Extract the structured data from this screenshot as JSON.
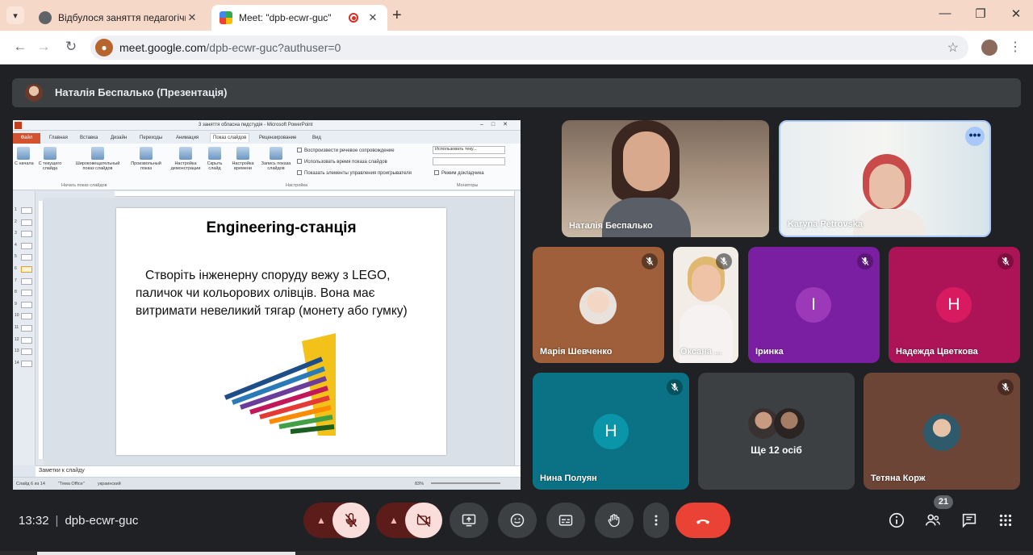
{
  "browser": {
    "tabs": [
      {
        "title": "Відбулося заняття педагогічно",
        "active": false
      },
      {
        "title": "Meet: \"dpb-ecwr-guc\"",
        "active": true,
        "recording": true
      }
    ],
    "url_host": "meet.google.com",
    "url_path": "/dpb-ecwr-guc?authuser=0"
  },
  "presenter": {
    "label": "Наталія Беспалько (Презентація)"
  },
  "ppt": {
    "window_title": "3 заняття обласна педстудія  -  Microsoft PowerPoint",
    "file_tab": "Файл",
    "tabs": [
      "Главная",
      "Вставка",
      "Дизайн",
      "Переходы",
      "Анимация",
      "Показ слайдов",
      "Рецензирование",
      "Вид"
    ],
    "ribbon_buttons": [
      "С начала",
      "С текущего слайда",
      "Широковещательный показ слайдов",
      "Произвольный показ",
      "Настройка демонстрации",
      "Скрыть слайд",
      "Настройка времени",
      "Запись показа слайдов"
    ],
    "checkboxes": [
      "Воспроизвести речевое сопровождение",
      "Использовать время показа слайдов",
      "Показать элементы управления проигрывателя"
    ],
    "monitor_select": "Использовать теку...",
    "presenter_view": "Режим докладчика",
    "groups": [
      "Начать показ слайдов",
      "Настройка",
      "Мониторы"
    ],
    "slide_numbers": [
      "1",
      "2",
      "3",
      "4",
      "5",
      "6",
      "7",
      "8",
      "9",
      "10",
      "11",
      "12",
      "13",
      "14"
    ],
    "slide": {
      "title": "Engineering-станція",
      "body": "Створіть інженерну споруду  вежу з LEGO, паличок чи кольорових олівців. Вона має витримати невеликий тягар (монету або гумку)"
    },
    "notes_placeholder": "Заметки к слайду",
    "status": {
      "slide_of": "Слайд 6 из 14",
      "theme": "\"Тема Office\"",
      "lang": "украинский",
      "zoom": "83%"
    }
  },
  "participants": {
    "natalia": {
      "name": "Наталія Беспалько"
    },
    "karyna": {
      "name": "Karyna Petrovska"
    },
    "maria": {
      "name": "Марія Шевченко"
    },
    "oksana": {
      "name": "Оксана ..."
    },
    "irynka": {
      "name": "Іринка",
      "initial": "І"
    },
    "nadezhda": {
      "name": "Надежда Цветкова",
      "initial": "Н"
    },
    "nina": {
      "name": "Нина Полуян",
      "initial": "Н"
    },
    "more": {
      "label": "Ще 12 осіб"
    },
    "tetiana": {
      "name": "Тетяна Корж"
    }
  },
  "footer": {
    "time": "13:32",
    "meeting_code": "dpb-ecwr-guc",
    "people_count": "21"
  },
  "colors": {
    "end_call": "#ea4335",
    "tab_strip": "#f6d8c9",
    "irynka_bg": "#7b1fa2",
    "nadezhda_bg": "#ad1457",
    "nina_bg": "#0b7285"
  }
}
